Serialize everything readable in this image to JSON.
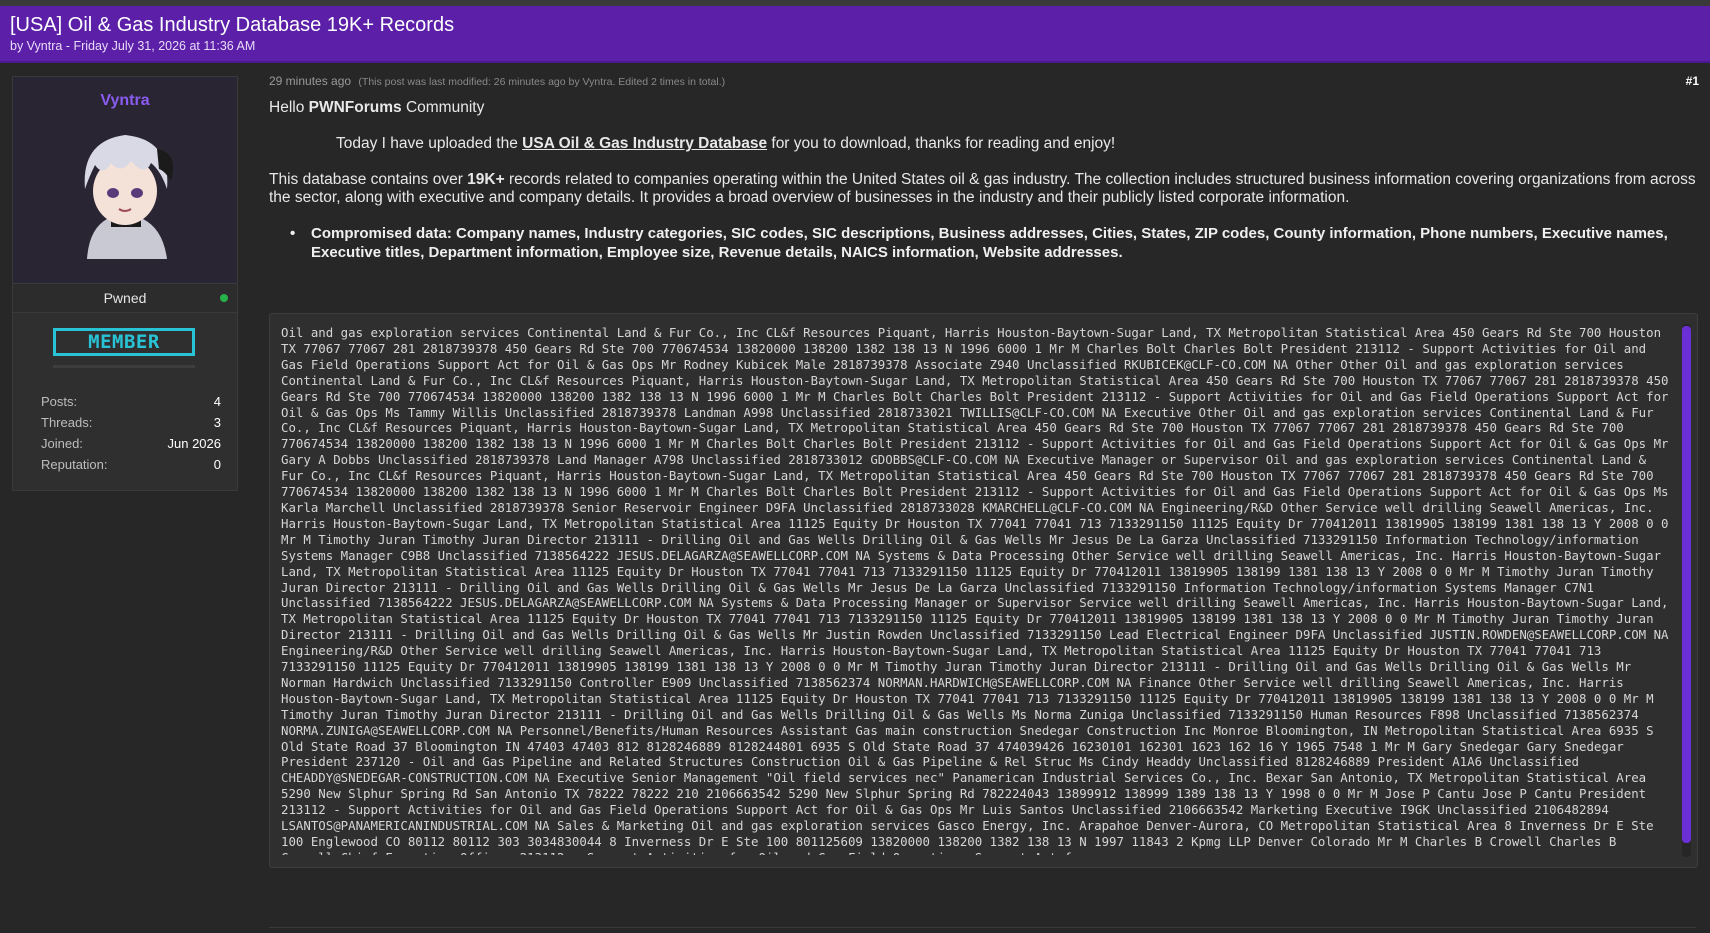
{
  "thread": {
    "title": "[USA] Oil & Gas Industry Database 19K+ Records",
    "byline": "by Vyntra - Friday July 31, 2026 at 11:36 AM"
  },
  "author": {
    "name": "Vyntra",
    "status": "Pwned",
    "rank": "MEMBER",
    "stats": [
      {
        "label": "Posts:",
        "value": "4"
      },
      {
        "label": "Threads:",
        "value": "3"
      },
      {
        "label": "Joined:",
        "value": "Jun 2026"
      },
      {
        "label": "Reputation:",
        "value": "0"
      }
    ]
  },
  "post": {
    "time": "29 minutes ago",
    "edit_note": "(This post was last modified: 26 minutes ago by Vyntra. Edited 2 times in total.)",
    "number": "#1",
    "greeting_prefix": "Hello ",
    "greeting_bold": "PWNForums",
    "greeting_suffix": " Community",
    "intro_prefix": "Today I have uploaded the ",
    "intro_link": "USA Oil & Gas Industry Database",
    "intro_suffix": " for you to download, thanks for reading and enjoy!",
    "desc_prefix": "This database contains over ",
    "desc_bold": "19K+",
    "desc_suffix": " records related to companies operating within the United States oil & gas industry. The collection includes structured business information covering organizations from across the sector, along with executive and company details. It provides a broad overview of businesses in the industry and their publicly listed corporate information.",
    "bullet": "Compromised data: Company names, Industry categories, SIC codes, SIC descriptions, Business addresses, Cities, States, ZIP codes, County information, Phone numbers, Executive names, Executive titles, Department information, Employee size, Revenue details, NAICS information, Website addresses.",
    "sample": "Oil and gas exploration services Continental Land & Fur Co., Inc CL&f Resources Piquant, Harris Houston-Baytown-Sugar Land, TX Metropolitan Statistical Area 450 Gears Rd Ste 700 Houston TX 77067 77067 281 2818739378 450 Gears Rd Ste 700 770674534 13820000 138200 1382 138 13 N 1996 6000 1 Mr M Charles Bolt Charles Bolt President 213112 - Support Activities for Oil and Gas Field Operations Support Act for Oil & Gas Ops Mr Rodney Kubicek Male 2818739378 Associate Z940 Unclassified RKUBICEK@CLF-CO.COM NA Other Other Oil and gas exploration services Continental Land & Fur Co., Inc CL&f Resources Piquant, Harris Houston-Baytown-Sugar Land, TX Metropolitan Statistical Area 450 Gears Rd Ste 700 Houston TX 77067 77067 281 2818739378 450 Gears Rd Ste 700 770674534 13820000 138200 1382 138 13 N 1996 6000 1 Mr M Charles Bolt Charles Bolt President 213112 - Support Activities for Oil and Gas Field Operations Support Act for Oil & Gas Ops Ms Tammy Willis Unclassified 2818739378 Landman A998 Unclassified 2818733021 TWILLIS@CLF-CO.COM NA Executive Other Oil and gas exploration services Continental Land & Fur Co., Inc CL&f Resources Piquant, Harris Houston-Baytown-Sugar Land, TX Metropolitan Statistical Area 450 Gears Rd Ste 700 Houston TX 77067 77067 281 2818739378 450 Gears Rd Ste 700 770674534 13820000 138200 1382 138 13 N 1996 6000 1 Mr M Charles Bolt Charles Bolt President 213112 - Support Activities for Oil and Gas Field Operations Support Act for Oil & Gas Ops Mr Gary A Dobbs Unclassified 2818739378 Land Manager A798 Unclassified 2818733012 GDOBBS@CLF-CO.COM NA Executive Manager or Supervisor Oil and gas exploration services Continental Land & Fur Co., Inc CL&f Resources Piquant, Harris Houston-Baytown-Sugar Land, TX Metropolitan Statistical Area 450 Gears Rd Ste 700 Houston TX 77067 77067 281 2818739378 450 Gears Rd Ste 700 770674534 13820000 138200 1382 138 13 N 1996 6000 1 Mr M Charles Bolt Charles Bolt President 213112 - Support Activities for Oil and Gas Field Operations Support Act for Oil & Gas Ops Ms Karla Marchell Unclassified 2818739378 Senior Reservoir Engineer D9FA Unclassified 2818733028 KMARCHELL@CLF-CO.COM NA Engineering/R&D Other Service well drilling Seawell Americas, Inc. Harris Houston-Baytown-Sugar Land, TX Metropolitan Statistical Area 11125 Equity Dr Houston TX 77041 77041 713 7133291150 11125 Equity Dr 770412011 13819905 138199 1381 138 13 Y 2008 0 0 Mr M Timothy Juran Timothy Juran Director 213111 - Drilling Oil and Gas Wells Drilling Oil & Gas Wells Mr Jesus De La Garza Unclassified 7133291150 Information Technology/information Systems Manager C9B8 Unclassified 7138564222 JESUS.DELAGARZA@SEAWELLCORP.COM NA Systems & Data Processing Other Service well drilling Seawell Americas, Inc. Harris Houston-Baytown-Sugar Land, TX Metropolitan Statistical Area 11125 Equity Dr Houston TX 77041 77041 713 7133291150 11125 Equity Dr 770412011 13819905 138199 1381 138 13 Y 2008 0 0 Mr M Timothy Juran Timothy Juran Director 213111 - Drilling Oil and Gas Wells Drilling Oil & Gas Wells Mr Jesus De La Garza Unclassified 7133291150 Information Technology/information Systems Manager C7N1 Unclassified 7138564222 JESUS.DELAGARZA@SEAWELLCORP.COM NA Systems & Data Processing Manager or Supervisor Service well drilling Seawell Americas, Inc. Harris Houston-Baytown-Sugar Land, TX Metropolitan Statistical Area 11125 Equity Dr Houston TX 77041 77041 713 7133291150 11125 Equity Dr 770412011 13819905 138199 1381 138 13 Y 2008 0 0 Mr M Timothy Juran Timothy Juran Director 213111 - Drilling Oil and Gas Wells Drilling Oil & Gas Wells Mr Justin Rowden Unclassified 7133291150 Lead Electrical Engineer D9FA Unclassified JUSTIN.ROWDEN@SEAWELLCORP.COM NA Engineering/R&D Other Service well drilling Seawell Americas, Inc. Harris Houston-Baytown-Sugar Land, TX Metropolitan Statistical Area 11125 Equity Dr Houston TX 77041 77041 713 7133291150 11125 Equity Dr 770412011 13819905 138199 1381 138 13 Y 2008 0 0 Mr M Timothy Juran Timothy Juran Director 213111 - Drilling Oil and Gas Wells Drilling Oil & Gas Wells Mr Norman Hardwich Unclassified 7133291150 Controller E909 Unclassified 7138562374 NORMAN.HARDWICH@SEAWELLCORP.COM NA Finance Other Service well drilling Seawell Americas, Inc. Harris Houston-Baytown-Sugar Land, TX Metropolitan Statistical Area 11125 Equity Dr Houston TX 77041 77041 713 7133291150 11125 Equity Dr 770412011 13819905 138199 1381 138 13 Y 2008 0 0 Mr M Timothy Juran Timothy Juran Director 213111 - Drilling Oil and Gas Wells Drilling Oil & Gas Wells Ms Norma Zuniga Unclassified 7133291150 Human Resources F898 Unclassified 7138562374 NORMA.ZUNIGA@SEAWELLCORP.COM NA Personnel/Benefits/Human Resources Assistant Gas main construction Snedegar Construction Inc Monroe Bloomington, IN Metropolitan Statistical Area 6935 S Old State Road 37 Bloomington IN 47403 47403 812 8128246889 8128244801 6935 S Old State Road 37 474039426 16230101 162301 1623 162 16 Y 1965 7548 1 Mr M Gary Snedegar Gary Snedegar President 237120 - Oil and Gas Pipeline and Related Structures Construction Oil & Gas Pipeline & Rel Struc Ms Cindy Headdy Unclassified 8128246889 President A1A6 Unclassified CHEADDY@SNEDEGAR-CONSTRUCTION.COM NA Executive Senior Management \"Oil field services nec\" Panamerican Industrial Services Co., Inc. Bexar San Antonio, TX Metropolitan Statistical Area 5290 New Slphur Spring Rd San Antonio TX 78222 78222 210 2106663542 5290 New Slphur Spring Rd 782224043 13899912 138999 1389 138 13 Y 1998 0 0 Mr M Jose P Cantu Jose P Cantu President 213112 - Support Activities for Oil and Gas Field Operations Support Act for Oil & Gas Ops Mr Luis Santos Unclassified 2106663542 Marketing Executive I9GK Unclassified 2106482894 LSANTOS@PANAMERICANINDUSTRIAL.COM NA Sales & Marketing Oil and gas exploration services Gasco Energy, Inc. Arapahoe Denver-Aurora, CO Metropolitan Statistical Area 8 Inverness Dr E Ste 100 Englewood CO 80112 80112 303 3034830044 8 Inverness Dr E Ste 100 801125609 13820000 138200 1382 138 13 N 1997 11843 2 Kpmg LLP Denver Colorado Mr M Charles B Crowell Charles B Crowell Chief Executive Officer 213112 - Support Activities for Oil and Gas Field Operations Support Act for"
  }
}
